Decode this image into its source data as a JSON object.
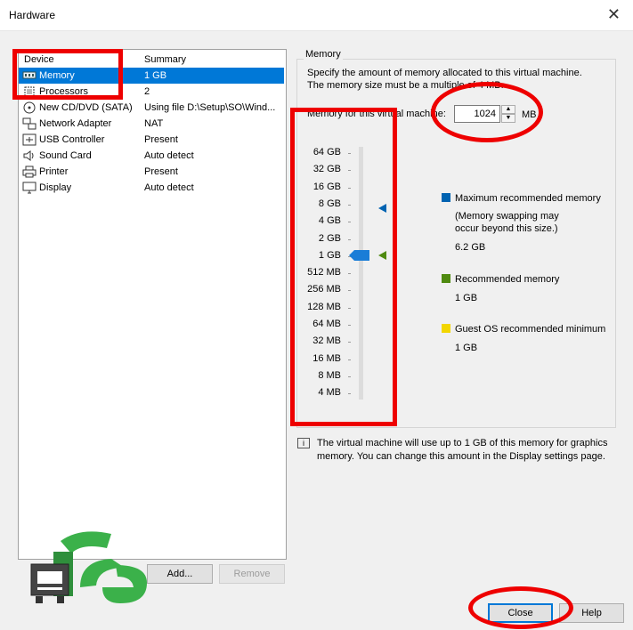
{
  "window": {
    "title": "Hardware"
  },
  "device_list": {
    "headers": {
      "device": "Device",
      "summary": "Summary"
    },
    "items": [
      {
        "name": "Memory",
        "summary": "1 GB",
        "icon": "memory-icon"
      },
      {
        "name": "Processors",
        "summary": "2",
        "icon": "processor-icon"
      },
      {
        "name": "New CD/DVD (SATA)",
        "summary": "Using file D:\\Setup\\SO\\Wind...",
        "icon": "cd-icon"
      },
      {
        "name": "Network Adapter",
        "summary": "NAT",
        "icon": "network-icon"
      },
      {
        "name": "USB Controller",
        "summary": "Present",
        "icon": "usb-icon"
      },
      {
        "name": "Sound Card",
        "summary": "Auto detect",
        "icon": "speaker-icon"
      },
      {
        "name": "Printer",
        "summary": "Present",
        "icon": "printer-icon"
      },
      {
        "name": "Display",
        "summary": "Auto detect",
        "icon": "monitor-icon"
      }
    ],
    "selected_index": 0
  },
  "buttons": {
    "add": "Add...",
    "remove": "Remove",
    "close": "Close",
    "help": "Help"
  },
  "memory": {
    "group_title": "Memory",
    "desc_line1": "Specify the amount of memory allocated to this virtual machine.",
    "desc_line2": "The memory size must be a multiple of 4 MB.",
    "field_label": "Memory for this virtual machine:",
    "value": "1024",
    "unit": "MB",
    "scale": [
      "64 GB",
      "32 GB",
      "16 GB",
      "8 GB",
      "4 GB",
      "2 GB",
      "1 GB",
      "512 MB",
      "256 MB",
      "128 MB",
      "64 MB",
      "32 MB",
      "16 MB",
      "8 MB",
      "4 MB"
    ],
    "legend": {
      "max_label": "Maximum recommended memory",
      "max_note1": "(Memory swapping may",
      "max_note2": "occur beyond this size.)",
      "max_value": "6.2 GB",
      "rec_label": "Recommended memory",
      "rec_value": "1 GB",
      "min_label": "Guest OS recommended minimum",
      "min_value": "1 GB"
    },
    "colors": {
      "max": "#0063b1",
      "rec": "#4f8a10",
      "min": "#f2d600",
      "thumb": "#1a7dd7"
    },
    "info_line1": "The virtual machine will use up to 1 GB of this memory for graphics",
    "info_line2": "memory. You can change this amount in the Display settings page."
  }
}
